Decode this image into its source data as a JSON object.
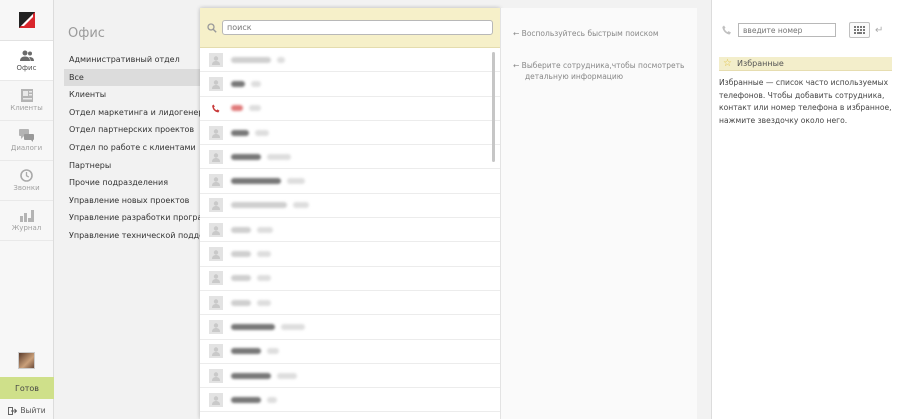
{
  "nav": {
    "items": [
      {
        "label": "Офис",
        "icon": "people-icon",
        "active": true
      },
      {
        "label": "Клиенты",
        "icon": "contacts-icon",
        "active": false
      },
      {
        "label": "Диалоги",
        "icon": "chat-icon",
        "active": false
      },
      {
        "label": "Звонки",
        "icon": "clock-icon",
        "active": false
      },
      {
        "label": "Журнал",
        "icon": "chart-icon",
        "active": false
      }
    ],
    "status_label": "Готов",
    "logout_label": "Выйти"
  },
  "departments": {
    "title": "Офис",
    "items": [
      "Административный отдел",
      "Все",
      "Клиенты",
      "Отдел маркетинга и лидогенерации",
      "Отдел партнерских проектов",
      "Отдел по работе с клиентами",
      "Партнеры",
      "Прочие подразделения",
      "Управление новых проектов",
      "Управление разработки программ",
      "Управление технической поддержки"
    ],
    "active_index": 1
  },
  "list": {
    "search_placeholder": "поиск"
  },
  "info": {
    "hint_search": "Воспользуйтесь быстрым поиском",
    "hint_select": "Выберите сотрудника,чтобы посмотреть детальную информацию"
  },
  "phone": {
    "number_placeholder": "введите номер",
    "favorites_title": "Избранные",
    "favorites_text": "Избранные — список часто используемых телефонов. Чтобы добавить сотрудника, контакт или номер телефона в избранное, нажмите звездочку около него."
  },
  "colors": {
    "accent_yellow": "#f6f0c9",
    "status_green": "#cfe08a",
    "logo_red": "#d9262c"
  }
}
